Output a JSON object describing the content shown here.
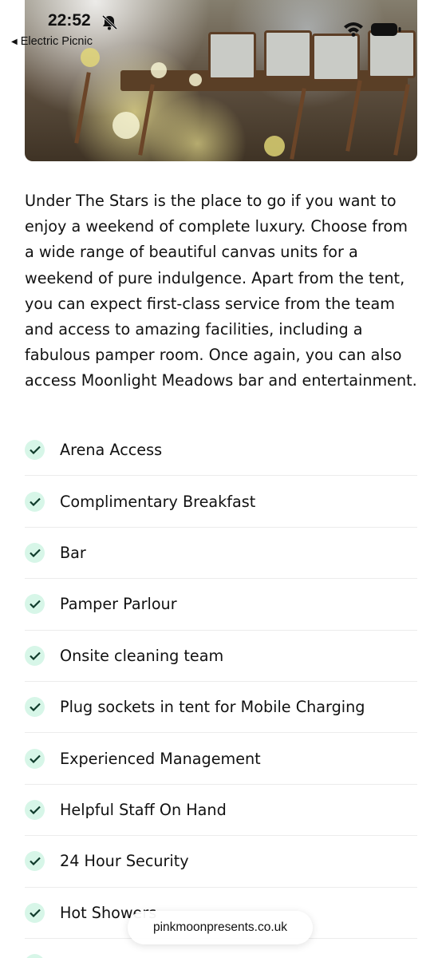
{
  "status_bar": {
    "time": "22:52",
    "back_label": "Electric Picnic",
    "icons": [
      "bell-slash-icon",
      "wifi-icon",
      "battery-icon"
    ]
  },
  "hero": {
    "image": "photo of outdoor dining area with canvas chairs and flowers"
  },
  "description": "Under The Stars is the place to go if you want to enjoy a weekend of complete luxury. Choose from a wide range of beautiful canvas units for a weekend of pure indulgence. Apart from the tent, you can expect first-class service from the team and access to amazing facilities, including a fabulous pamper room. Once again, you can also access Moonlight Meadows bar and entertainment.",
  "amenities": [
    {
      "label": "Arena Access"
    },
    {
      "label": "Complimentary Breakfast"
    },
    {
      "label": "Bar"
    },
    {
      "label": "Pamper Parlour"
    },
    {
      "label": "Onsite cleaning team"
    },
    {
      "label": "Plug sockets in tent for Mobile Charging"
    },
    {
      "label": "Experienced Management"
    },
    {
      "label": "Helpful Staff On Hand"
    },
    {
      "label": "24 Hour Security"
    },
    {
      "label": "Hot Showers"
    },
    {
      "label": ""
    }
  ],
  "url_bar": {
    "domain": "pinkmoonpresents.co.uk"
  },
  "colors": {
    "check_badge_bg": "#d7f6e8",
    "check_mark": "#0f3b2b",
    "divider": "#ececec"
  }
}
